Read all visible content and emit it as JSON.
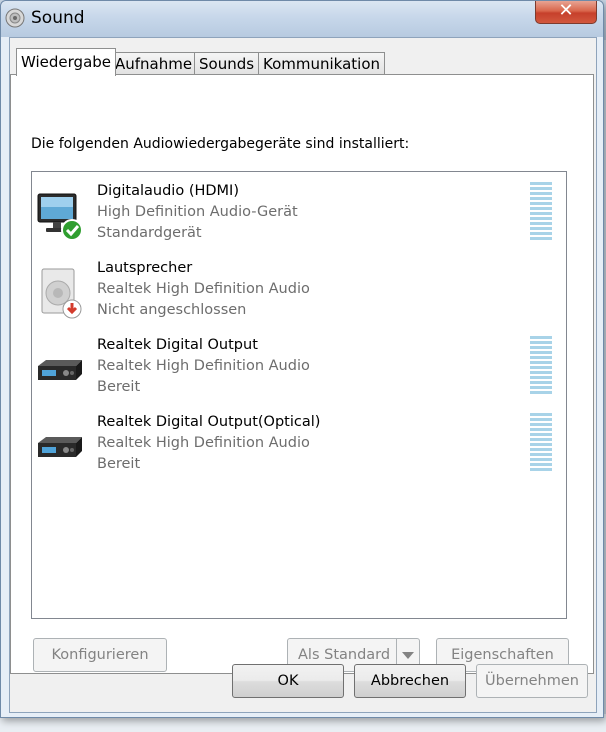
{
  "window": {
    "title": "Sound",
    "close_label": "✕"
  },
  "tabs": [
    {
      "label": "Wiedergabe",
      "active": true
    },
    {
      "label": "Aufnahme",
      "active": false
    },
    {
      "label": "Sounds",
      "active": false
    },
    {
      "label": "Kommunikation",
      "active": false
    }
  ],
  "playback": {
    "intro": "Die folgenden Audiowiedergabegeräte sind installiert:",
    "devices": [
      {
        "name": "Digitalaudio (HDMI)",
        "driver": "High Definition Audio-Gerät",
        "status": "Standardgerät",
        "icon": "monitor-icon",
        "badge": "default-check-icon",
        "meter": true
      },
      {
        "name": "Lautsprecher",
        "driver": "Realtek High Definition Audio",
        "status": "Nicht angeschlossen",
        "icon": "speaker-icon",
        "badge": "disconnected-icon",
        "meter": false
      },
      {
        "name": "Realtek Digital Output",
        "driver": "Realtek High Definition Audio",
        "status": "Bereit",
        "icon": "digital-output-icon",
        "badge": "",
        "meter": true
      },
      {
        "name": "Realtek Digital Output(Optical)",
        "driver": "Realtek High Definition Audio",
        "status": "Bereit",
        "icon": "digital-output-icon",
        "badge": "",
        "meter": true
      }
    ],
    "buttons": {
      "configure": "Konfigurieren",
      "set_default": "Als Standard",
      "properties": "Eigenschaften"
    }
  },
  "dialog_buttons": {
    "ok": "OK",
    "cancel": "Abbrechen",
    "apply": "Übernehmen"
  },
  "colors": {
    "meter": "#a8d3e8",
    "accent_check": "#2f9e2f",
    "disconnected": "#d33b2c"
  }
}
